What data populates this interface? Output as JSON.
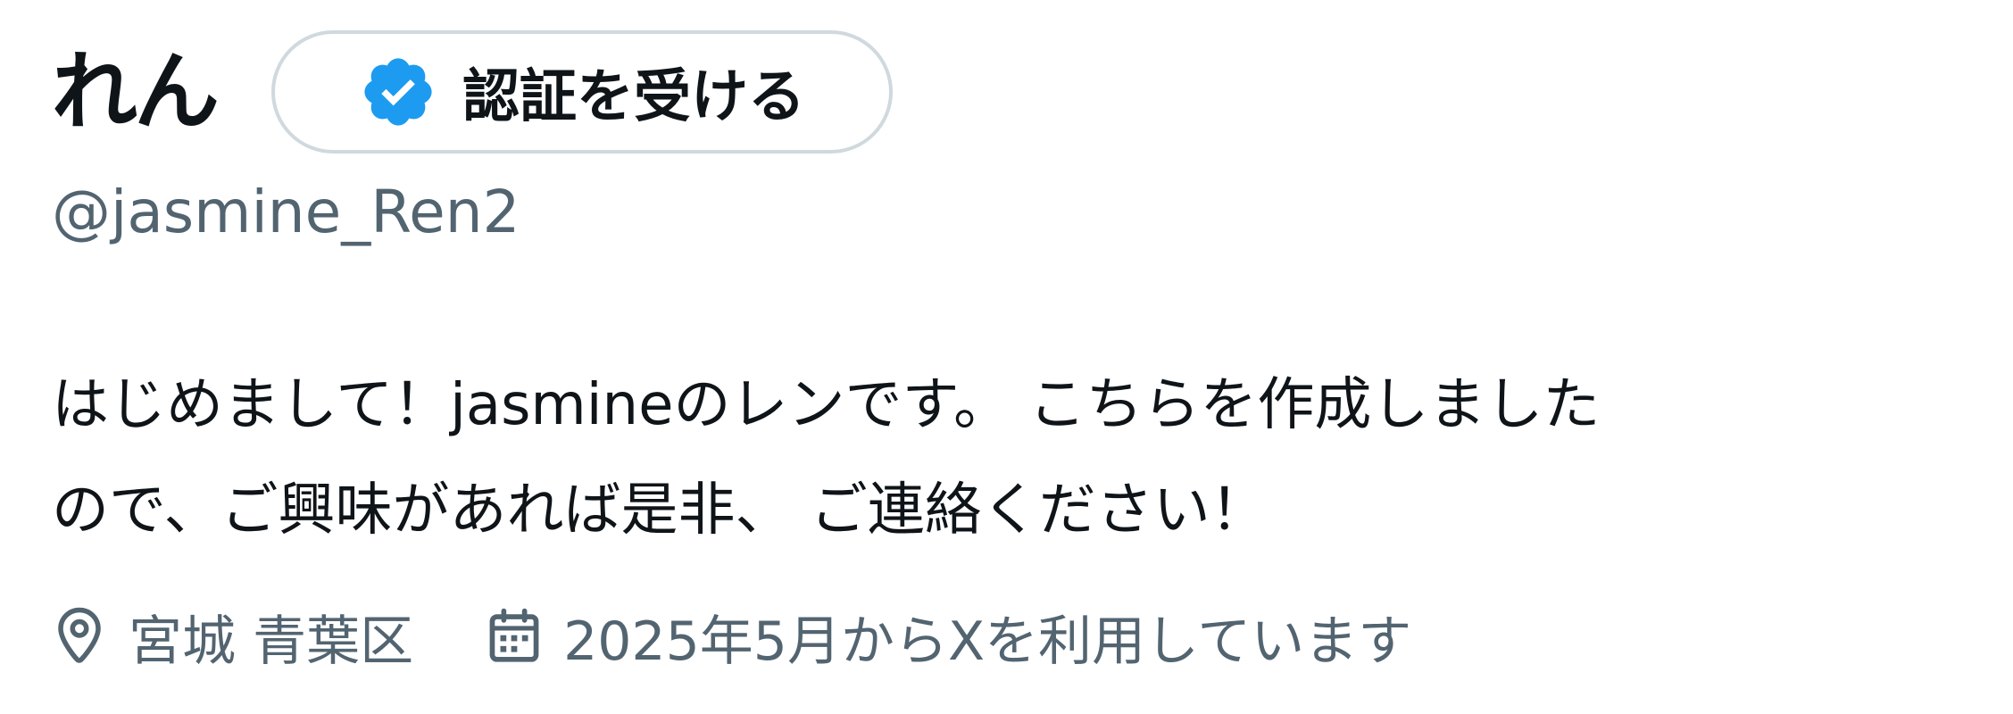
{
  "profile": {
    "display_name": "れん",
    "verify_button_label": "認証を受ける",
    "verify_badge_icon": "verified-badge-icon",
    "handle": "@jasmine_Ren2",
    "bio": "はじめまして！jasmineのレンです。 こちらを作成しました\nので、ご興味があれば是非、 ご連絡ください！",
    "location": "宮城 青葉区",
    "joined": "2025年5月からXを利用しています",
    "location_icon": "location-pin-icon",
    "calendar_icon": "calendar-icon"
  },
  "colors": {
    "text_primary": "#0f1419",
    "text_secondary": "#536471",
    "verified_blue": "#1d9bf0",
    "button_border": "#cfd9de"
  }
}
